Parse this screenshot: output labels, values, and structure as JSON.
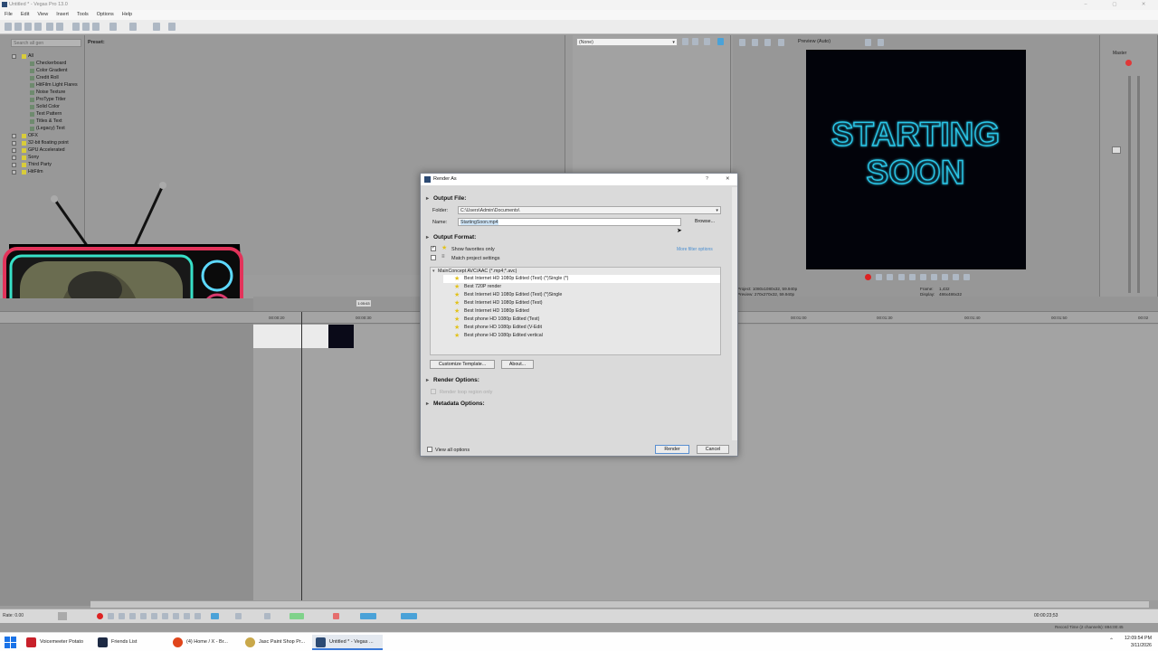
{
  "app": {
    "title": "Untitled * - Vegas Pro 13.0",
    "menu": [
      "File",
      "Edit",
      "View",
      "Insert",
      "Tools",
      "Options",
      "Help"
    ]
  },
  "media_generators": {
    "search_placeholder": "Search all gen",
    "preset_label": "Preset:",
    "tree": {
      "root": "All",
      "items": [
        "Checkerboard",
        "Color Gradient",
        "Credit Roll",
        "HitFilm Light Flares",
        "Noise Texture",
        "ProType Titler",
        "Solid Color",
        "Text Pattern",
        "Titles & Text",
        "(Legacy) Text"
      ],
      "groups": [
        "OFX",
        "32-bit floating point",
        "GPU Accelerated",
        "Sony",
        "Third Party",
        "HitFilm"
      ]
    }
  },
  "fx_dropdown": "(None)",
  "preview": {
    "mode": "Preview (Auto)",
    "overlay_line1": "STARTING",
    "overlay_line2": "SOON",
    "project_info": "Project:  1080x1080x32, 59.940p",
    "preview_info": "Preview:  270x270x32, 59.940p",
    "frame_label": "Frame:",
    "frame_value": "1,432",
    "display_label": "Display:",
    "display_value": "486x486x32"
  },
  "mixer": {
    "master_label": "Master"
  },
  "timeline": {
    "marker": "1:05:63",
    "ruler": [
      "00:00:20",
      "00:00:30",
      "00:01:00",
      "00:01:30",
      "00:01:40",
      "00:01:50",
      "00:02"
    ],
    "rate_label": "Rate: 0.00",
    "timecode": "00:00:23;53",
    "record_time": "Record Time (2 channels): 894:00:45"
  },
  "dialog": {
    "title": "Render As",
    "help": "?",
    "close": "✕",
    "output_file": "Output File:",
    "folder_label": "Folder:",
    "folder_value": "C:\\Users\\Admin\\Documents\\",
    "name_label": "Name:",
    "name_value": "StartingSoon.mp4",
    "browse": "Browse...",
    "output_format": "Output Format:",
    "show_favorites": "Show favorites only",
    "match_project": "Match project settings",
    "more_filter": "More filter options",
    "format_group": "MainConcept AVC/AAC (*.mp4;*.avc)",
    "templates": [
      "Best Internet HD 1080p Edited (Test) (*)Single (*)",
      "Best 720P render",
      "Best Internet HD 1080p Edited (Test) (*)Single",
      "Best Internet HD 1080p Edited (Test)",
      "Best Internet HD 1080p Edited",
      "Best phone HD 1080p Edited (Test)",
      "Best phone HD 1080p Edited (V-Edit",
      "Best phone HD 1080p Edited vertical"
    ],
    "customize": "Customize Template...",
    "about": "About...",
    "render_options": "Render Options:",
    "render_loop": "Render loop region only",
    "metadata_options": "Metadata Options:",
    "view_all": "View all options",
    "render": "Render",
    "cancel": "Cancel"
  },
  "taskbar": {
    "items": [
      "Voicemeeter Potato",
      "Friends List",
      "(4) Home / X - Br...",
      "Jasc Paint Shop Pr...",
      "Untitled * - Vegas ..."
    ],
    "time": "12:09:54 PM",
    "date": "3/11/2026"
  },
  "colors": {
    "dialog_bg": "#dadada",
    "selection": "#ffffff",
    "star": "#e2c21b",
    "neon_text": "#2cc7e8"
  }
}
